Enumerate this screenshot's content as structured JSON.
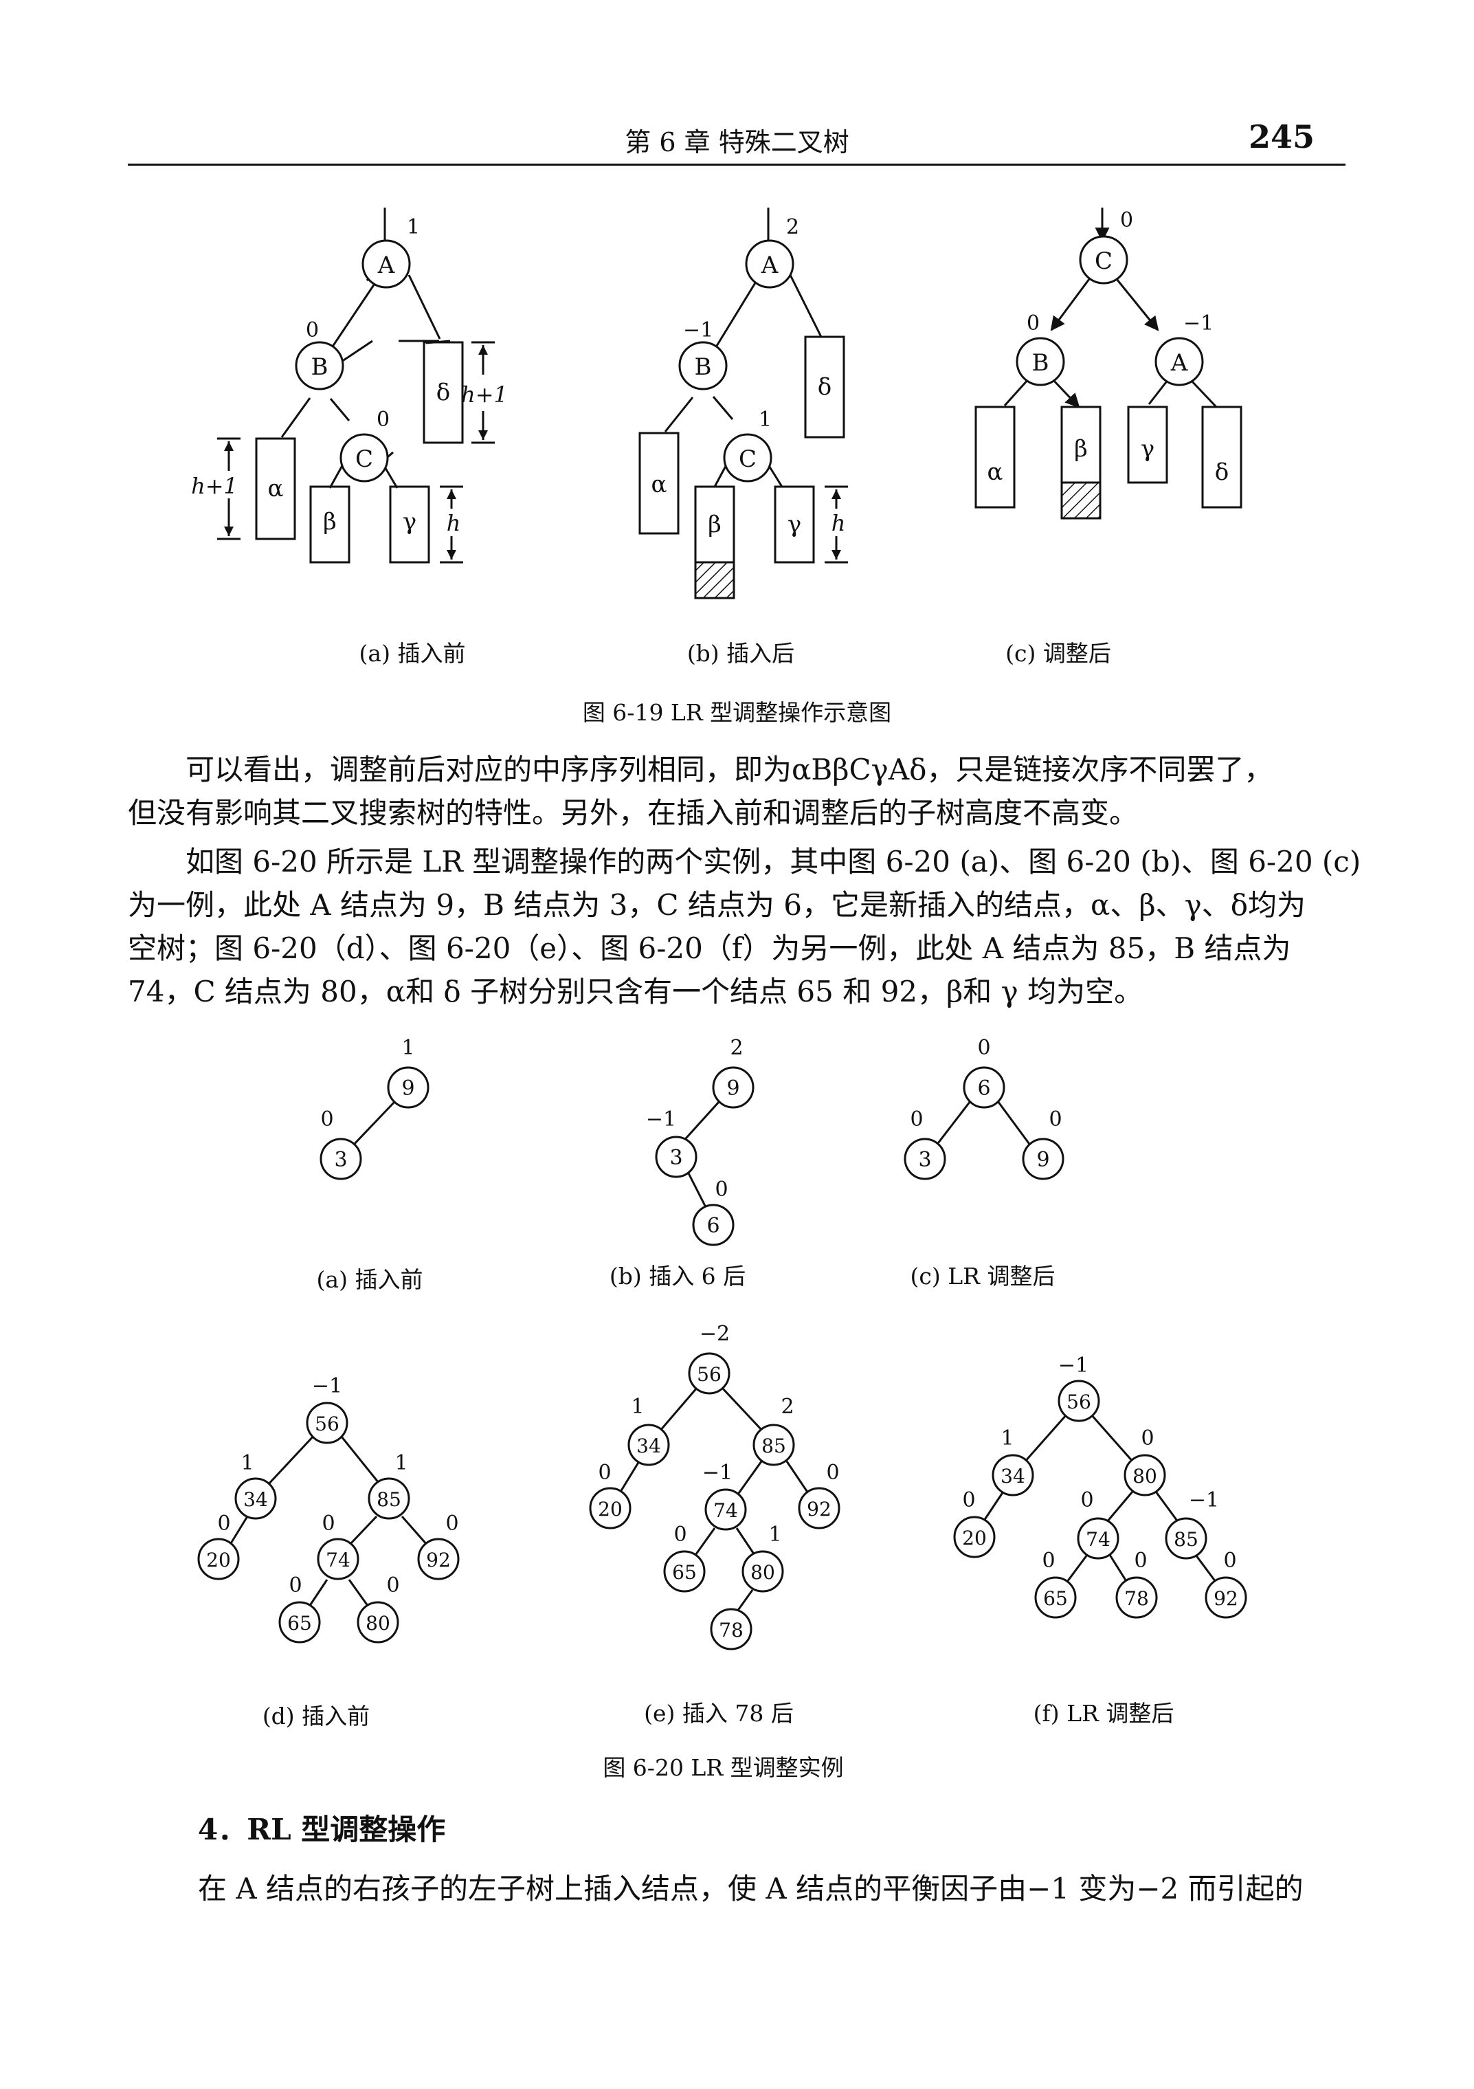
{
  "header": {
    "chapter": "第 6 章   特殊二叉树",
    "page_number": "245"
  },
  "figure_6_19": {
    "caption": "图 6-19   LR 型调整操作示意图",
    "panels": [
      {
        "label": "(a) 插入前",
        "nodes": [
          {
            "id": "A",
            "bf": "1"
          },
          {
            "id": "B",
            "bf": "0"
          },
          {
            "id": "C",
            "bf": "0"
          }
        ],
        "subtrees": [
          "α",
          "β",
          "γ",
          "δ"
        ],
        "height_labels": [
          "h+1",
          "h+1",
          "h"
        ]
      },
      {
        "label": "(b) 插入后",
        "nodes": [
          {
            "id": "A",
            "bf": "2"
          },
          {
            "id": "B",
            "bf": "−1"
          },
          {
            "id": "C",
            "bf": "1"
          }
        ],
        "subtrees": [
          "α",
          "β",
          "γ",
          "δ"
        ],
        "height_labels": [
          "h"
        ]
      },
      {
        "label": "(c) 调整后",
        "nodes": [
          {
            "id": "C",
            "bf": "0"
          },
          {
            "id": "B",
            "bf": "0"
          },
          {
            "id": "A",
            "bf": "−1"
          }
        ],
        "subtrees": [
          "α",
          "β",
          "γ",
          "δ"
        ],
        "height_labels": []
      }
    ]
  },
  "paragraphs": [
    [
      "可以看出，调整前后对应的中序序列相同，即为αBβCγAδ，只是链接次序不同罢了，",
      "但没有影响其二叉搜索树的特性。另外，在插入前和调整后的子树高度不高变。"
    ],
    [
      "如图 6-20 所示是 LR 型调整操作的两个实例，其中图 6-20 (a)、图 6-20 (b)、图 6-20 (c)",
      "为一例，此处 A 结点为 9，B 结点为 3，C 结点为 6，它是新插入的结点，α、β、γ、δ均为",
      "空树；图 6-20（d）、图 6-20（e）、图 6-20（f）为另一例，此处 A 结点为 85，B 结点为",
      "74，C 结点为 80，α和 δ 子树分别只含有一个结点 65 和 92，β和 γ 均为空。"
    ]
  ],
  "figure_6_20": {
    "caption": "图 6-20   LR 型调整实例",
    "panels": [
      {
        "label": "(a) 插入前",
        "nodes": [
          {
            "key": "9",
            "bf": "1"
          },
          {
            "key": "3",
            "bf": "0"
          }
        ]
      },
      {
        "label": "(b) 插入 6 后",
        "nodes": [
          {
            "key": "9",
            "bf": "2"
          },
          {
            "key": "3",
            "bf": "−1"
          },
          {
            "key": "6",
            "bf": "0"
          }
        ]
      },
      {
        "label": "(c) LR 调整后",
        "nodes": [
          {
            "key": "6",
            "bf": "0"
          },
          {
            "key": "3",
            "bf": "0"
          },
          {
            "key": "9",
            "bf": "0"
          }
        ]
      },
      {
        "label": "(d) 插入前",
        "nodes": [
          {
            "key": "56",
            "bf": "−1"
          },
          {
            "key": "34",
            "bf": "1"
          },
          {
            "key": "85",
            "bf": "1"
          },
          {
            "key": "20",
            "bf": "0"
          },
          {
            "key": "74",
            "bf": "0"
          },
          {
            "key": "92",
            "bf": "0"
          },
          {
            "key": "65",
            "bf": "0"
          },
          {
            "key": "80",
            "bf": "0"
          }
        ]
      },
      {
        "label": "(e) 插入 78 后",
        "nodes": [
          {
            "key": "56",
            "bf": "−2"
          },
          {
            "key": "34",
            "bf": "1"
          },
          {
            "key": "85",
            "bf": "2"
          },
          {
            "key": "20",
            "bf": "0"
          },
          {
            "key": "74",
            "bf": "−1"
          },
          {
            "key": "92",
            "bf": "0"
          },
          {
            "key": "65",
            "bf": "0"
          },
          {
            "key": "80",
            "bf": "1"
          },
          {
            "key": "78",
            "bf": ""
          }
        ]
      },
      {
        "label": "(f) LR 调整后",
        "nodes": [
          {
            "key": "56",
            "bf": "−1"
          },
          {
            "key": "34",
            "bf": "1"
          },
          {
            "key": "80",
            "bf": "0"
          },
          {
            "key": "20",
            "bf": "0"
          },
          {
            "key": "74",
            "bf": "0"
          },
          {
            "key": "85",
            "bf": "−1"
          },
          {
            "key": "65",
            "bf": "0"
          },
          {
            "key": "78",
            "bf": "0"
          },
          {
            "key": "92",
            "bf": "0"
          }
        ]
      }
    ]
  },
  "section": {
    "heading": "4．RL 型调整操作"
  },
  "final_paragraph": [
    "在 A 结点的右孩子的左子树上插入结点，使 A 结点的平衡因子由−1 变为−2 而引起的"
  ]
}
